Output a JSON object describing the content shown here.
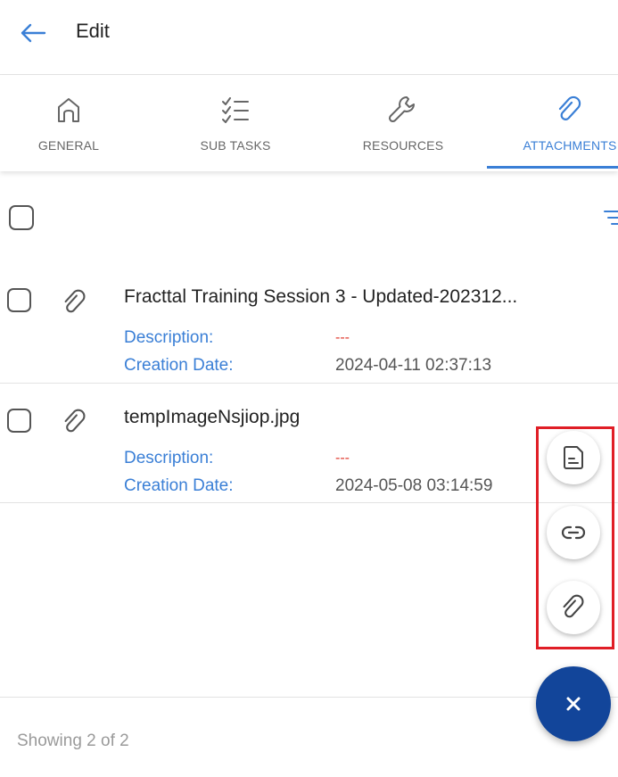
{
  "header": {
    "title": "Edit",
    "back_icon": "arrow-left-icon"
  },
  "tabs": [
    {
      "label": "GENERAL",
      "icon": "home-icon",
      "active": false
    },
    {
      "label": "SUB TASKS",
      "icon": "checklist-icon",
      "active": false
    },
    {
      "label": "RESOURCES",
      "icon": "wrench-icon",
      "active": false
    },
    {
      "label": "ATTACHMENTS",
      "icon": "paperclip-icon",
      "active": true
    }
  ],
  "list": {
    "description_label": "Description:",
    "creation_date_label": "Creation Date:",
    "items": [
      {
        "title": "Fracttal Training Session 3 - Updated-202312...",
        "description": "---",
        "creation_date": "2024-04-11 02:37:13"
      },
      {
        "title": "tempImageNsjiop.jpg",
        "description": "---",
        "creation_date": "2024-05-08 03:14:59"
      }
    ]
  },
  "footer": {
    "showing": "Showing 2 of 2"
  },
  "fab": {
    "actions": [
      "document-icon",
      "link-icon",
      "paperclip-icon"
    ],
    "main_icon": "close-icon",
    "main_label": "×"
  },
  "colors": {
    "accent": "#3a7fd6",
    "fab": "#12459a",
    "highlight": "#e01e26",
    "empty_value": "#e03b2f"
  }
}
